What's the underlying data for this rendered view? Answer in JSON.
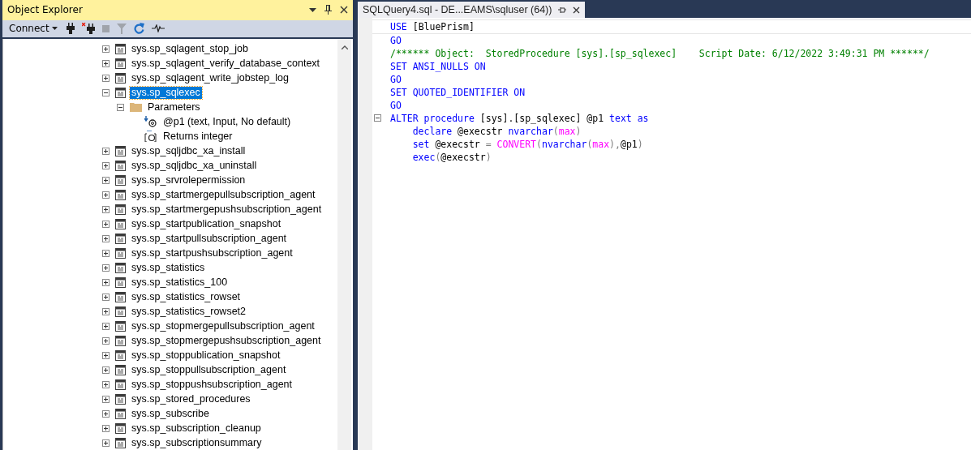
{
  "object_explorer": {
    "title": "Object Explorer",
    "toolbar": {
      "connect_label": "Connect"
    },
    "tree": [
      {
        "label": "sys.sp_sqlagent_stop_job",
        "expanded": false,
        "selected": false
      },
      {
        "label": "sys.sp_sqlagent_verify_database_context",
        "expanded": false,
        "selected": false
      },
      {
        "label": "sys.sp_sqlagent_write_jobstep_log",
        "expanded": false,
        "selected": false
      },
      {
        "label": "sys.sp_sqlexec",
        "expanded": true,
        "selected": true,
        "children": [
          {
            "label": "Parameters",
            "kind": "folder",
            "expanded": true,
            "selected": false,
            "children": [
              {
                "label": "@p1 (text, Input, No default)",
                "kind": "param",
                "selected": false
              },
              {
                "label": "Returns integer",
                "kind": "return",
                "selected": false
              }
            ]
          }
        ]
      },
      {
        "label": "sys.sp_sqljdbc_xa_install",
        "expanded": false,
        "selected": false
      },
      {
        "label": "sys.sp_sqljdbc_xa_uninstall",
        "expanded": false,
        "selected": false
      },
      {
        "label": "sys.sp_srvrolepermission",
        "expanded": false,
        "selected": false
      },
      {
        "label": "sys.sp_startmergepullsubscription_agent",
        "expanded": false,
        "selected": false
      },
      {
        "label": "sys.sp_startmergepushsubscription_agent",
        "expanded": false,
        "selected": false
      },
      {
        "label": "sys.sp_startpublication_snapshot",
        "expanded": false,
        "selected": false
      },
      {
        "label": "sys.sp_startpullsubscription_agent",
        "expanded": false,
        "selected": false
      },
      {
        "label": "sys.sp_startpushsubscription_agent",
        "expanded": false,
        "selected": false
      },
      {
        "label": "sys.sp_statistics",
        "expanded": false,
        "selected": false
      },
      {
        "label": "sys.sp_statistics_100",
        "expanded": false,
        "selected": false
      },
      {
        "label": "sys.sp_statistics_rowset",
        "expanded": false,
        "selected": false
      },
      {
        "label": "sys.sp_statistics_rowset2",
        "expanded": false,
        "selected": false
      },
      {
        "label": "sys.sp_stopmergepullsubscription_agent",
        "expanded": false,
        "selected": false
      },
      {
        "label": "sys.sp_stopmergepushsubscription_agent",
        "expanded": false,
        "selected": false
      },
      {
        "label": "sys.sp_stoppublication_snapshot",
        "expanded": false,
        "selected": false
      },
      {
        "label": "sys.sp_stoppullsubscription_agent",
        "expanded": false,
        "selected": false
      },
      {
        "label": "sys.sp_stoppushsubscription_agent",
        "expanded": false,
        "selected": false
      },
      {
        "label": "sys.sp_stored_procedures",
        "expanded": false,
        "selected": false
      },
      {
        "label": "sys.sp_subscribe",
        "expanded": false,
        "selected": false
      },
      {
        "label": "sys.sp_subscription_cleanup",
        "expanded": false,
        "selected": false
      },
      {
        "label": "sys.sp_subscriptionsummary",
        "expanded": false,
        "selected": false
      }
    ]
  },
  "editor": {
    "tab": {
      "title": "SQLQuery4.sql - DE...EAMS\\sqluser (64))",
      "selected": true
    },
    "lines": [
      {
        "segments": [
          {
            "kind": "keyword",
            "text": "USE"
          },
          {
            "kind": "plain",
            "text": " [BluePrism]"
          }
        ]
      },
      {
        "segments": [
          {
            "kind": "keyword",
            "text": "GO"
          }
        ]
      },
      {
        "segments": [
          {
            "kind": "comment",
            "text": "/****** Object:  StoredProcedure [sys].[sp_sqlexec]    Script Date: 6/12/2022 3:49:31 PM ******/"
          }
        ]
      },
      {
        "segments": [
          {
            "kind": "keyword",
            "text": "SET ANSI_NULLS ON"
          }
        ]
      },
      {
        "segments": [
          {
            "kind": "keyword",
            "text": "GO"
          }
        ]
      },
      {
        "segments": [
          {
            "kind": "keyword",
            "text": "SET QUOTED_IDENTIFIER ON"
          }
        ]
      },
      {
        "segments": [
          {
            "kind": "keyword",
            "text": "GO"
          }
        ]
      },
      {
        "fold_expanded": true,
        "segments": [
          {
            "kind": "keyword",
            "text": "ALTER procedure"
          },
          {
            "kind": "plain",
            "text": " [sys].[sp_sqlexec] @p1 "
          },
          {
            "kind": "keyword",
            "text": "text as"
          }
        ]
      },
      {
        "segments": [
          {
            "kind": "keyword",
            "text": "    declare"
          },
          {
            "kind": "plain",
            "text": " @execstr "
          },
          {
            "kind": "keyword",
            "text": "nvarchar"
          },
          {
            "kind": "punct",
            "text": "("
          },
          {
            "kind": "function",
            "text": "max"
          },
          {
            "kind": "punct",
            "text": ")"
          }
        ]
      },
      {
        "segments": [
          {
            "kind": "keyword",
            "text": "    set"
          },
          {
            "kind": "plain",
            "text": " @execstr "
          },
          {
            "kind": "punct",
            "text": "= "
          },
          {
            "kind": "function",
            "text": "CONVERT"
          },
          {
            "kind": "punct",
            "text": "("
          },
          {
            "kind": "keyword",
            "text": "nvarchar"
          },
          {
            "kind": "punct",
            "text": "("
          },
          {
            "kind": "function",
            "text": "max"
          },
          {
            "kind": "punct",
            "text": "),"
          },
          {
            "kind": "plain",
            "text": "@p1"
          },
          {
            "kind": "punct",
            "text": ")"
          }
        ]
      },
      {
        "segments": [
          {
            "kind": "keyword",
            "text": "    exec"
          },
          {
            "kind": "punct",
            "text": "("
          },
          {
            "kind": "plain",
            "text": "@execstr"
          },
          {
            "kind": "punct",
            "text": ")"
          }
        ]
      }
    ]
  }
}
